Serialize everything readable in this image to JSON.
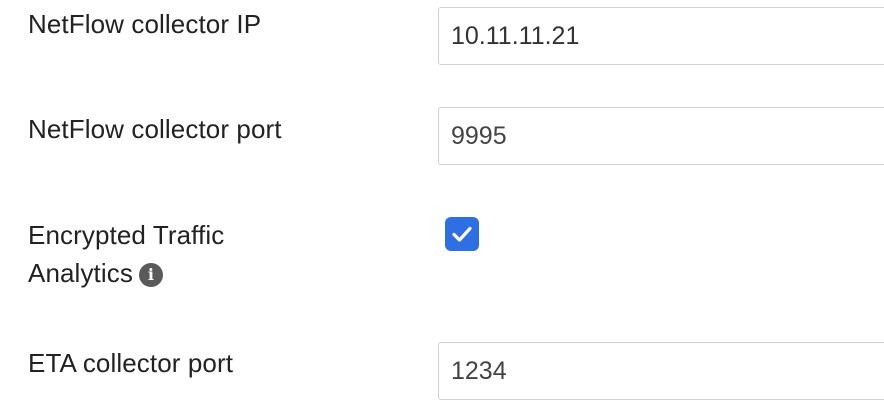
{
  "fields": {
    "netflow_ip": {
      "label": "NetFlow collector IP",
      "value": "10.11.11.21"
    },
    "netflow_port": {
      "label": "NetFlow collector port",
      "value": "9995"
    },
    "eta": {
      "label_line1": "Encrypted Traffic",
      "label_line2": "Analytics",
      "checked": true,
      "info_icon": "info-circle-icon"
    },
    "eta_port": {
      "label": "ETA collector port",
      "value": "1234"
    }
  },
  "colors": {
    "checkbox_accent": "#2f6fe4",
    "input_border": "#cfd3d7",
    "label_text": "#222222"
  }
}
